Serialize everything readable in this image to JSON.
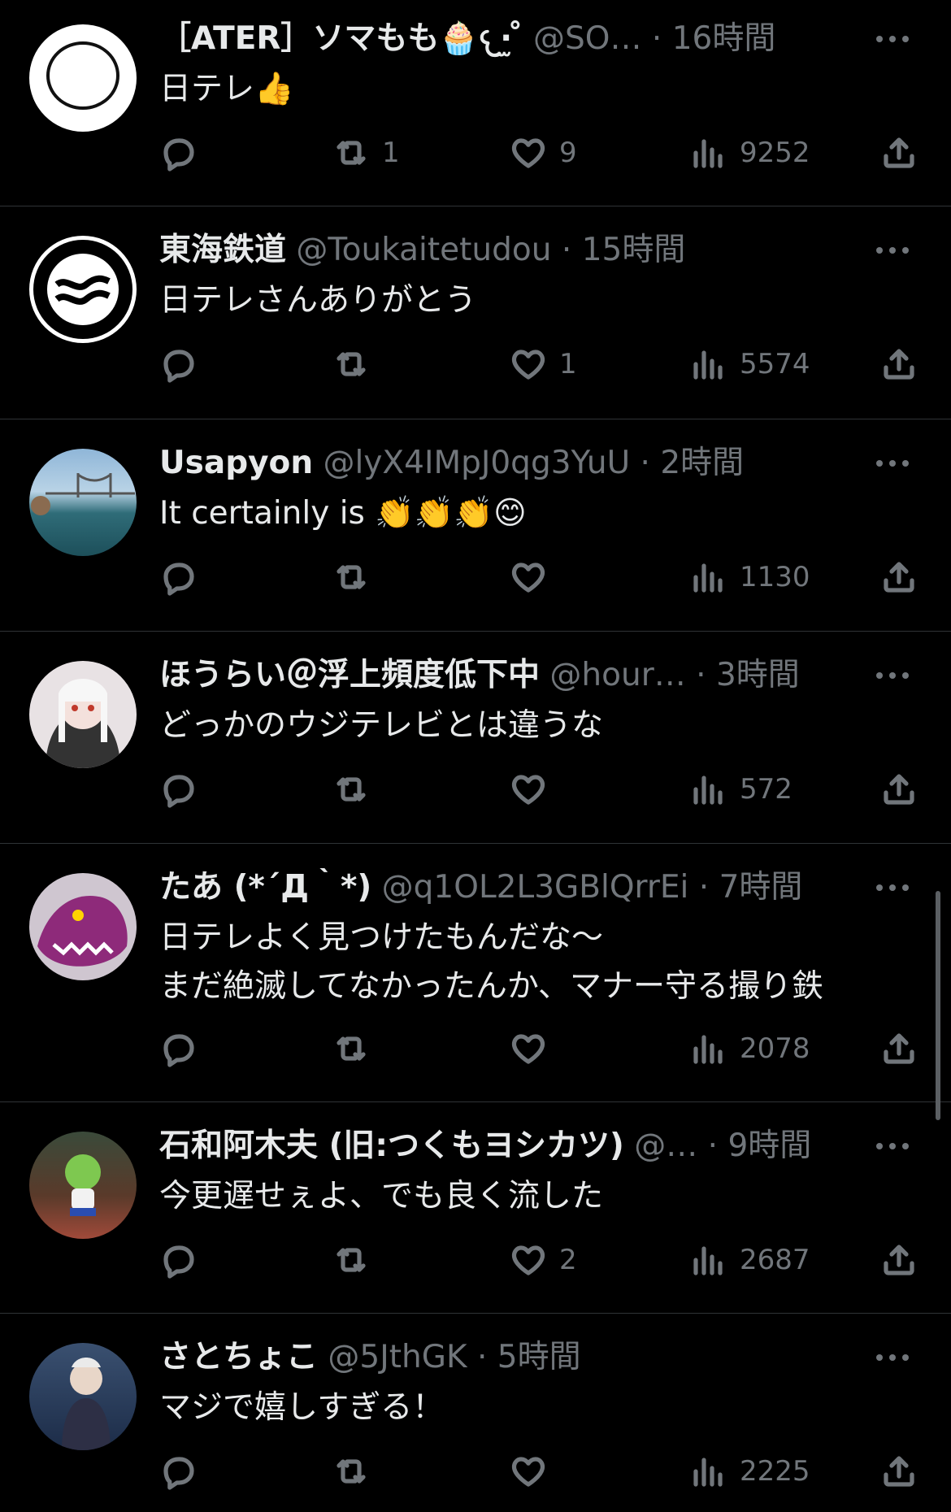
{
  "tweets": [
    {
      "name": "［ATER］ソマもも🧁‪𐔌·̫ ̊",
      "handle": "@SO…",
      "dot": "·",
      "time": "16時間",
      "text": "日テレ👍",
      "reply": "",
      "retweets": "1",
      "likes": "9",
      "views": "9252"
    },
    {
      "name": "東海鉄道",
      "handle": "@Toukaitetudou",
      "dot": "·",
      "time": "15時間",
      "text": "日テレさんありがとう",
      "reply": "",
      "retweets": "",
      "likes": "1",
      "views": "5574"
    },
    {
      "name": "Usapyon",
      "handle": "@lyX4IMpJ0qg3YuU",
      "dot": "·",
      "time": "2時間",
      "text": "It certainly is 👏👏👏😊",
      "reply": "",
      "retweets": "",
      "likes": "",
      "views": "1130"
    },
    {
      "name": "ほうらい＠浮上頻度低下中",
      "handle": "@hour…",
      "dot": "·",
      "time": "3時間",
      "text": "どっかのウジテレビとは違うな",
      "reply": "",
      "retweets": "",
      "likes": "",
      "views": "572"
    },
    {
      "name": "たあ (*´Д｀*)",
      "handle": "@q1OL2L3GBlQrrEi",
      "dot": "·",
      "time": "7時間",
      "text": "日テレよく見つけたもんだな〜\nまだ絶滅してなかったんか、マナー守る撮り鉄",
      "reply": "",
      "retweets": "",
      "likes": "",
      "views": "2078"
    },
    {
      "name": "石和阿木夫 (旧:つくもヨシカツ)",
      "handle": "@…",
      "dot": "·",
      "time": "9時間",
      "text": "今更遅せぇよ、でも良く流した",
      "reply": "",
      "retweets": "",
      "likes": "2",
      "views": "2687"
    },
    {
      "name": "さとちょこ",
      "handle": "@5JthGK",
      "dot": "·",
      "time": "5時間",
      "text": "マジで嬉しすぎる！",
      "reply": "",
      "retweets": "",
      "likes": "",
      "views": "2225"
    }
  ],
  "icons": {
    "reply": "reply-icon",
    "retweet": "retweet-icon",
    "like": "heart-icon",
    "views": "views-icon",
    "share": "share-icon",
    "more": "more-icon"
  },
  "colors": {
    "background": "#000000",
    "text": "#e7e9ea",
    "secondary": "#71767b",
    "divider": "#2f3336"
  }
}
